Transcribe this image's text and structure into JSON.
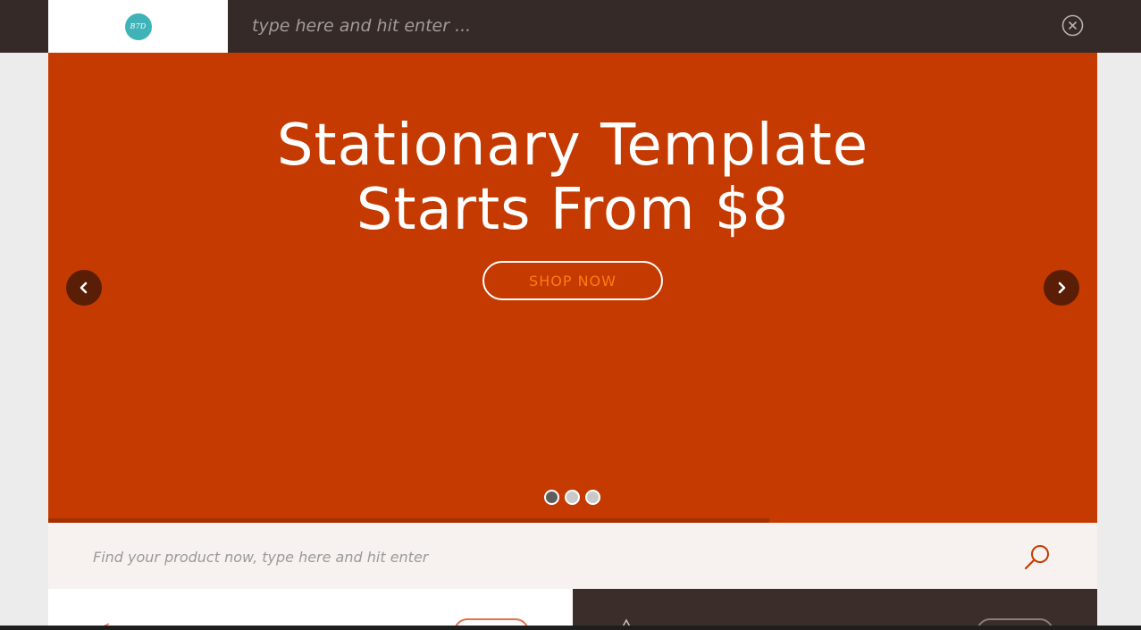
{
  "header": {
    "logo_text": "B7D",
    "search_placeholder": "type here and hit enter ..."
  },
  "hero": {
    "title_line1": "Stationary Template",
    "title_line2": "Starts From $8",
    "cta_label": "SHOP NOW",
    "active_slide": 1,
    "slide_count": 3,
    "progress_fraction": 0.687
  },
  "product_search": {
    "placeholder": "Find your product now, type here and hit enter"
  },
  "colors": {
    "hero_background": "#c53a00",
    "topbar_background": "#352a28",
    "cta_text": "#ff7a10",
    "logo_badge": "#3fb3b8"
  },
  "icons": {
    "close": "close-circle-icon",
    "prev": "chevron-left-icon",
    "next": "chevron-right-icon",
    "search": "search-icon"
  }
}
